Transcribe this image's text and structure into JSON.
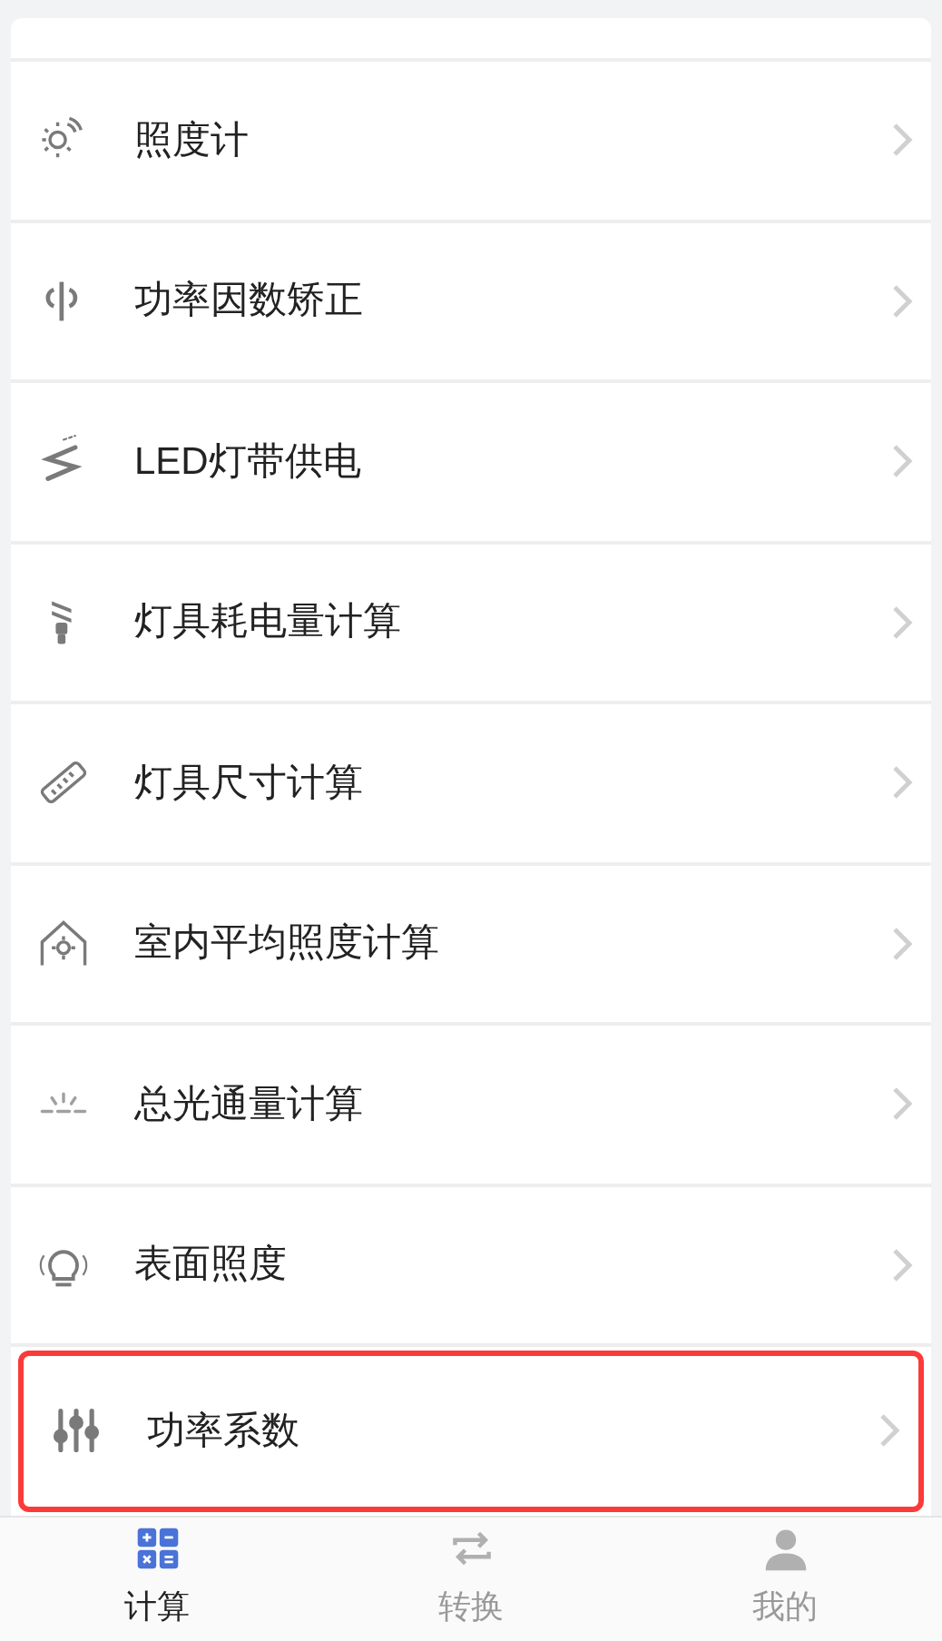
{
  "items": [
    {
      "label": "照度计",
      "highlighted": false
    },
    {
      "label": "功率因数矫正",
      "highlighted": false
    },
    {
      "label": "LED灯带供电",
      "highlighted": false
    },
    {
      "label": "灯具耗电量计算",
      "highlighted": false
    },
    {
      "label": "灯具尺寸计算",
      "highlighted": false
    },
    {
      "label": "室内平均照度计算",
      "highlighted": false
    },
    {
      "label": "总光通量计算",
      "highlighted": false
    },
    {
      "label": "表面照度",
      "highlighted": false
    },
    {
      "label": "功率系数",
      "highlighted": true
    }
  ],
  "tabs": [
    {
      "label": "计算",
      "selected": true
    },
    {
      "label": "转换",
      "selected": false
    },
    {
      "label": "我的",
      "selected": false
    }
  ]
}
